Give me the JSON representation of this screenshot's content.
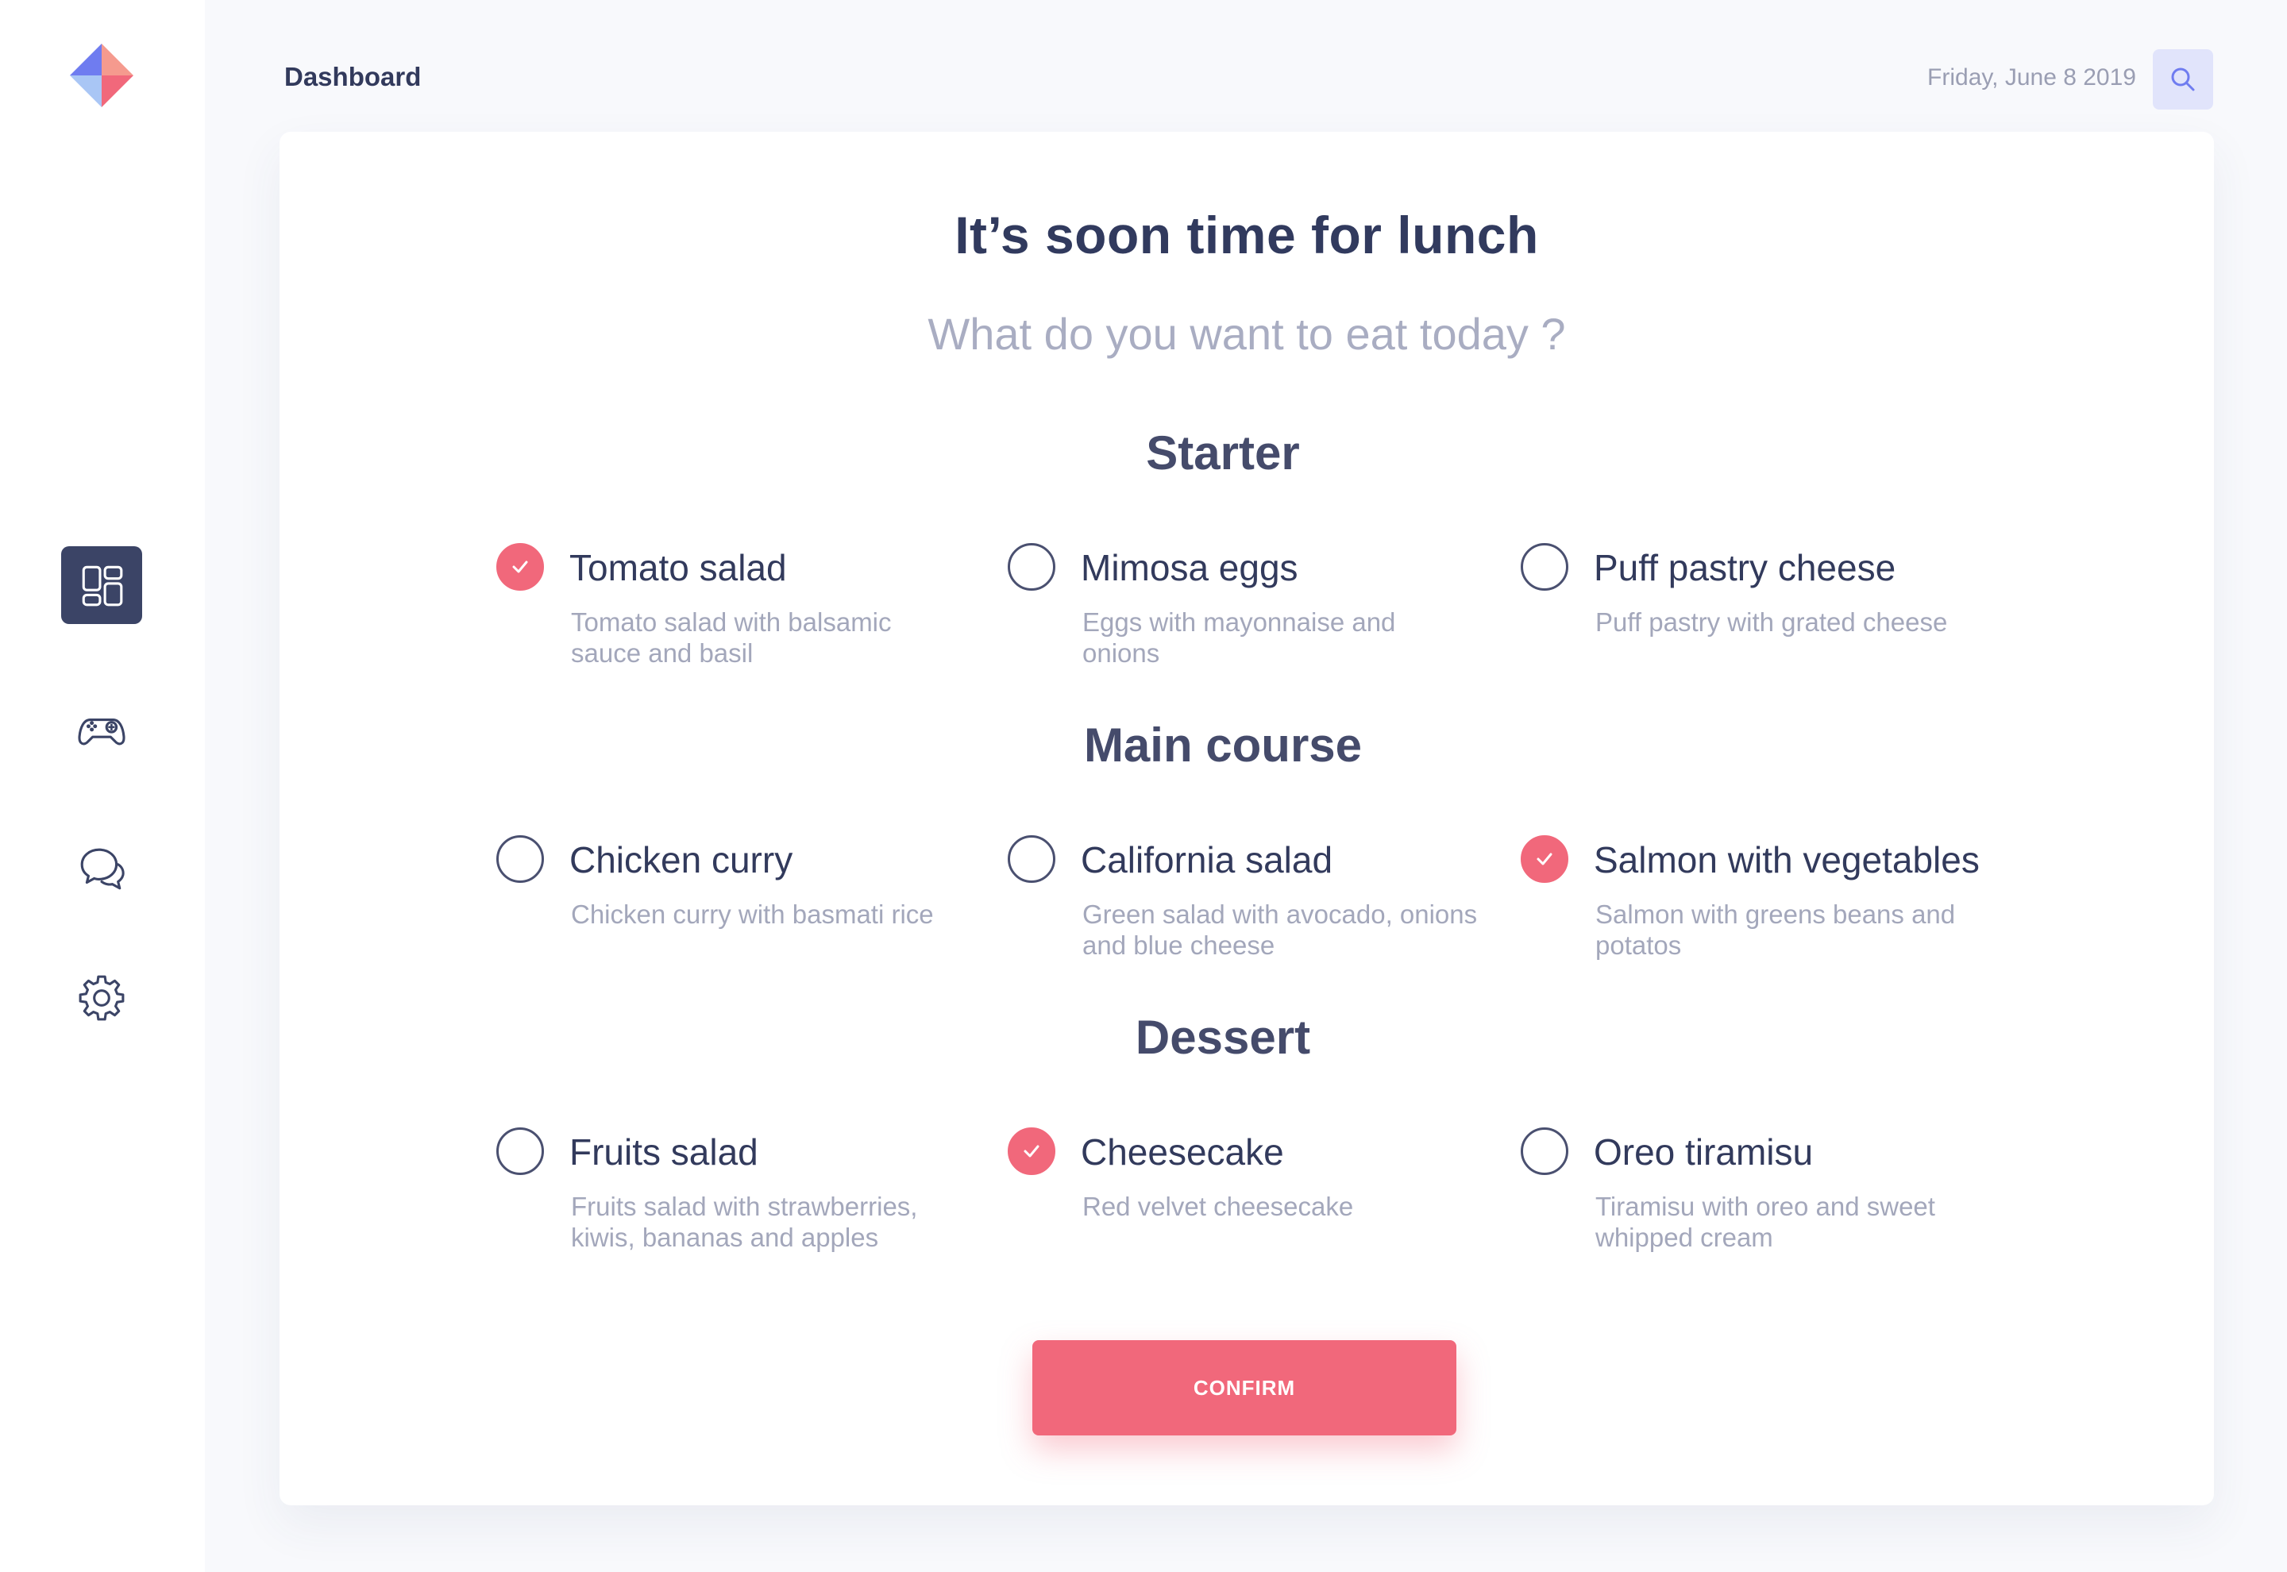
{
  "header": {
    "title": "Dashboard",
    "date": "Friday, June 8 2019"
  },
  "sidebar": {
    "items": [
      {
        "icon": "dashboard-icon",
        "active": true
      },
      {
        "icon": "gamepad-icon",
        "active": false
      },
      {
        "icon": "chat-icon",
        "active": false
      },
      {
        "icon": "gear-icon",
        "active": false
      }
    ]
  },
  "card": {
    "title": "It’s soon time for lunch",
    "subtitle": "What do you want to eat today ?"
  },
  "sections": [
    {
      "title": "Starter",
      "options": [
        {
          "name": "Tomato salad",
          "description": "Tomato salad with balsamic sauce and basil",
          "checked": true
        },
        {
          "name": "Mimosa eggs",
          "description": "Eggs with mayonnaise and onions",
          "checked": false
        },
        {
          "name": "Puff pastry cheese",
          "description": "Puff pastry with grated cheese",
          "checked": false
        }
      ]
    },
    {
      "title": "Main course",
      "options": [
        {
          "name": "Chicken curry",
          "description": "Chicken curry with basmati rice",
          "checked": false
        },
        {
          "name": "California salad",
          "description": "Green salad with avocado, onions and blue cheese",
          "checked": false
        },
        {
          "name": "Salmon with vegetables",
          "description": "Salmon with greens beans and potatos",
          "checked": true
        }
      ]
    },
    {
      "title": "Dessert",
      "options": [
        {
          "name": "Fruits salad",
          "description": "Fruits salad with strawberries, kiwis, bananas and apples",
          "checked": false
        },
        {
          "name": "Cheesecake",
          "description": "Red velvet cheesecake",
          "checked": true
        },
        {
          "name": "Oreo tiramisu",
          "description": "Tiramisu with oreo and sweet whipped cream",
          "checked": false
        }
      ]
    }
  ],
  "confirm": {
    "label": "CONFIRM"
  },
  "colors": {
    "accent": "#f1687b",
    "primary_text": "#323a5c",
    "muted_text": "#a3a7bb",
    "active_nav": "#3b4466",
    "search_bg": "#e1e4fb"
  }
}
